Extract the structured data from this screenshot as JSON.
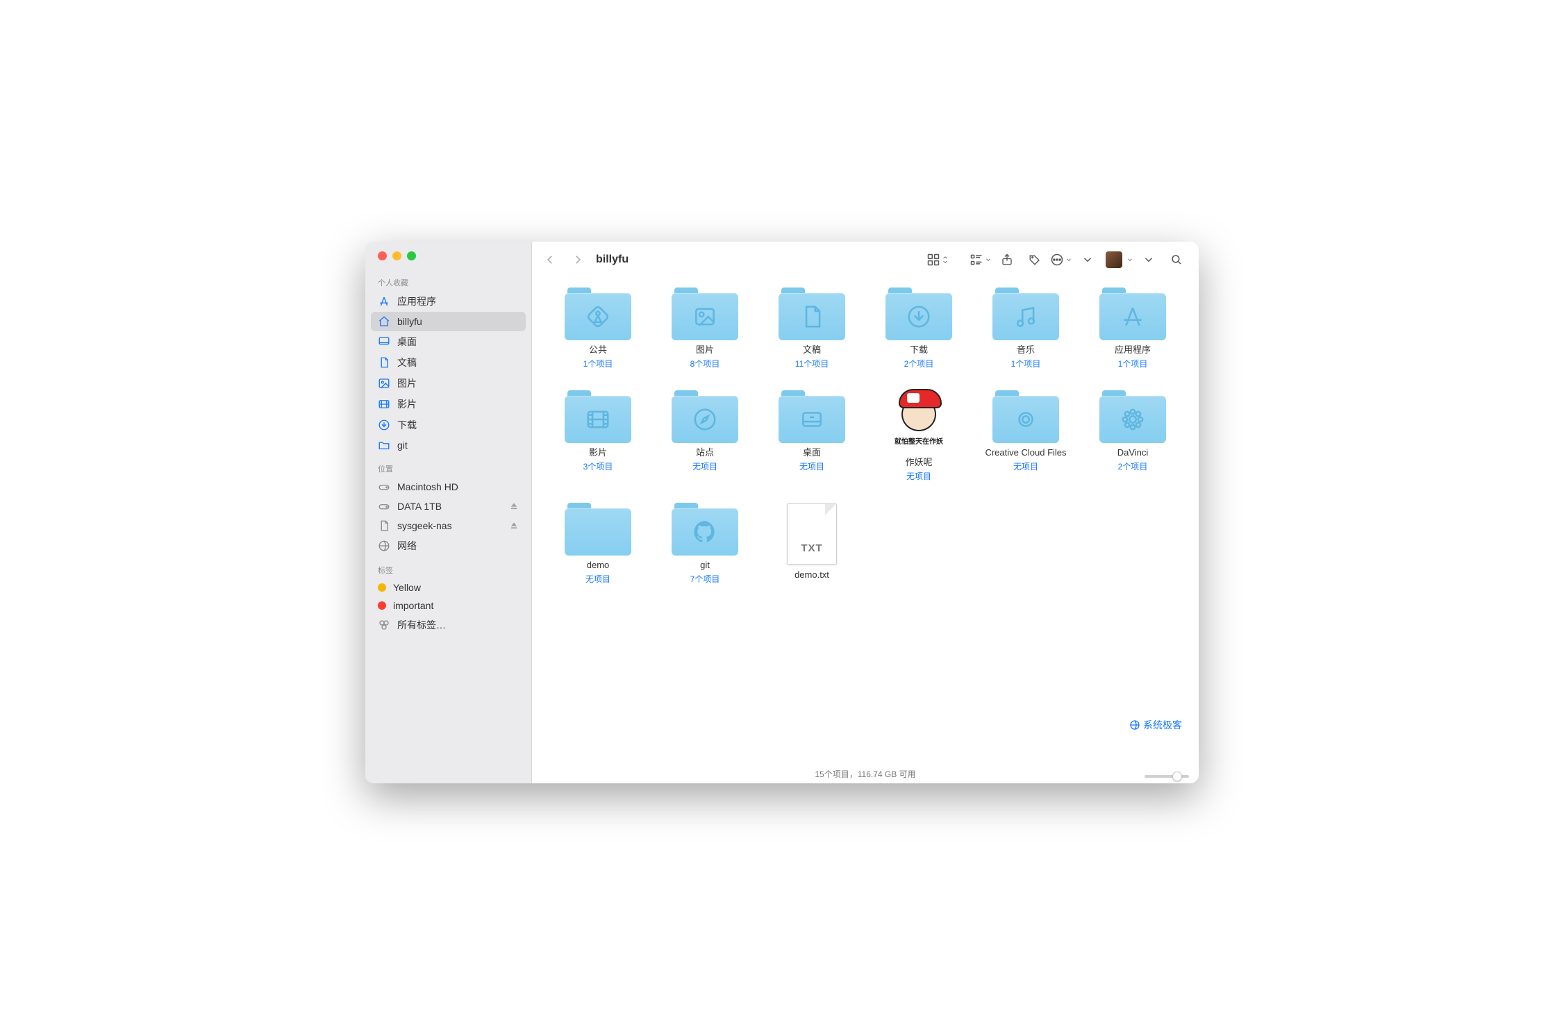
{
  "window": {
    "title": "billyfu"
  },
  "sidebar": {
    "sections": {
      "favorites": {
        "heading": "个人收藏",
        "items": [
          {
            "id": "apps",
            "label": "应用程序",
            "icon": "app-store"
          },
          {
            "id": "billyfu",
            "label": "billyfu",
            "icon": "home",
            "active": true
          },
          {
            "id": "desktop",
            "label": "桌面",
            "icon": "desktop"
          },
          {
            "id": "docs",
            "label": "文稿",
            "icon": "doc"
          },
          {
            "id": "pics",
            "label": "图片",
            "icon": "picture"
          },
          {
            "id": "movies",
            "label": "影片",
            "icon": "movie"
          },
          {
            "id": "download",
            "label": "下载",
            "icon": "download"
          },
          {
            "id": "git",
            "label": "git",
            "icon": "folder"
          }
        ]
      },
      "locations": {
        "heading": "位置",
        "items": [
          {
            "id": "mac",
            "label": "Macintosh HD",
            "icon": "drive"
          },
          {
            "id": "data",
            "label": "DATA 1TB",
            "icon": "drive",
            "eject": true
          },
          {
            "id": "nas",
            "label": "sysgeek-nas",
            "icon": "doc",
            "eject": true
          },
          {
            "id": "net",
            "label": "网络",
            "icon": "globe"
          }
        ]
      },
      "tags": {
        "heading": "标签",
        "items": [
          {
            "id": "yellow",
            "label": "Yellow",
            "color": "#f7b500"
          },
          {
            "id": "important",
            "label": "important",
            "color": "#ff3b30"
          },
          {
            "id": "all",
            "label": "所有标签…",
            "icon": "all-tags"
          }
        ]
      }
    }
  },
  "files": [
    {
      "name": "公共",
      "sub": "1个项目",
      "kind": "folder",
      "glyph": "public"
    },
    {
      "name": "图片",
      "sub": "8个项目",
      "kind": "folder",
      "glyph": "picture"
    },
    {
      "name": "文稿",
      "sub": "11个项目",
      "kind": "folder",
      "glyph": "doc"
    },
    {
      "name": "下载",
      "sub": "2个项目",
      "kind": "folder",
      "glyph": "download"
    },
    {
      "name": "音乐",
      "sub": "1个项目",
      "kind": "folder",
      "glyph": "music"
    },
    {
      "name": "应用程序",
      "sub": "1个项目",
      "kind": "folder",
      "glyph": "apps"
    },
    {
      "name": "影片",
      "sub": "3个项目",
      "kind": "folder",
      "glyph": "movie"
    },
    {
      "name": "站点",
      "sub": "无项目",
      "kind": "folder",
      "glyph": "compass"
    },
    {
      "name": "桌面",
      "sub": "无项目",
      "kind": "folder",
      "glyph": "desktop"
    },
    {
      "name": "作妖呢",
      "sub": "无项目",
      "kind": "meme",
      "caption": "就怕整天在作妖"
    },
    {
      "name": "Creative Cloud Files",
      "sub": "无项目",
      "kind": "folder",
      "glyph": "creative"
    },
    {
      "name": "DaVinci",
      "sub": "2个项目",
      "kind": "folder",
      "glyph": "davinci"
    },
    {
      "name": "demo",
      "sub": "无项目",
      "kind": "folder",
      "glyph": "plain"
    },
    {
      "name": "git",
      "sub": "7个项目",
      "kind": "folder",
      "glyph": "github"
    },
    {
      "name": "demo.txt",
      "sub": "",
      "kind": "txt",
      "badge": "TXT"
    }
  ],
  "statusbar": "15个项目，116.74 GB 可用",
  "watermark": "系统极客",
  "colors": {
    "accent": "#1677ff",
    "folder1": "#9fd8f3",
    "folder2": "#86cef0"
  }
}
